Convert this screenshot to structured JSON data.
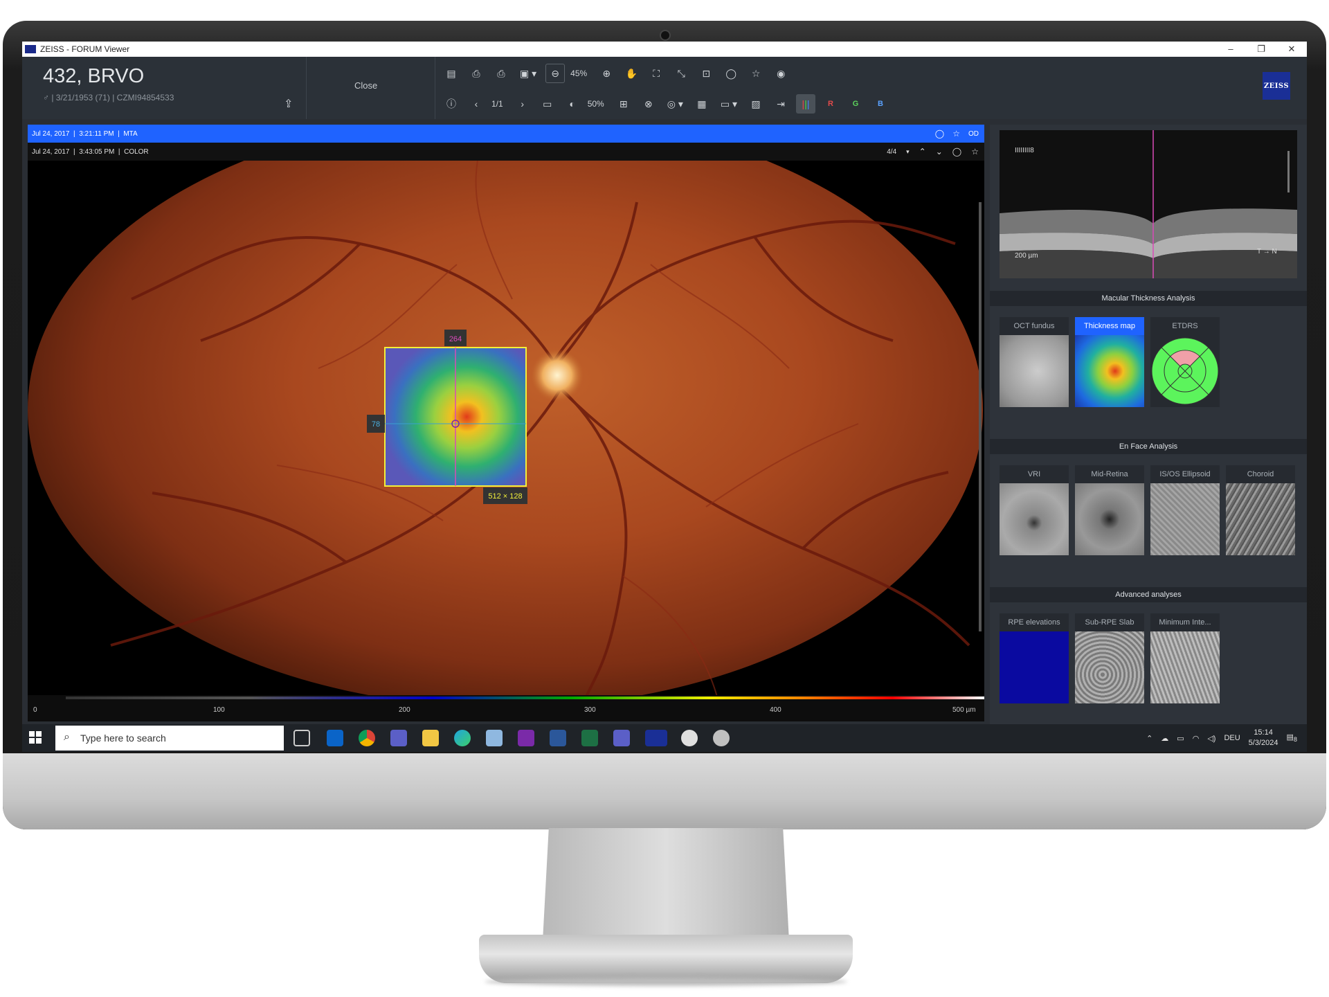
{
  "window": {
    "title": "ZEISS - FORUM Viewer",
    "min": "–",
    "max": "❐",
    "close": "✕"
  },
  "patient": {
    "name": "432, BRVO",
    "gender_icon": "♂",
    "dob": "3/21/1953 (71)",
    "id": "CZMI94854533"
  },
  "header": {
    "close_label": "Close"
  },
  "toolbar": {
    "zoom": "45%",
    "page": "1/1",
    "opacity": "50%",
    "red": "R",
    "green": "G",
    "blue": "B"
  },
  "study_bar": {
    "date": "Jul 24, 2017",
    "time": "3:21:11 PM",
    "modality": "MTA",
    "eye": "OD"
  },
  "image_bar": {
    "date": "Jul 24, 2017",
    "time": "3:43:05 PM",
    "type": "COLOR",
    "count": "4/4"
  },
  "overlay": {
    "top_value": "264",
    "left_value": "78",
    "size": "512 × 128"
  },
  "scale": {
    "labels": [
      "0",
      "100",
      "200",
      "300",
      "400",
      "500 µm"
    ]
  },
  "oct": {
    "scale_label": "200 µm",
    "orientation": "T → N",
    "marker": "IIIIIIII8"
  },
  "macular": {
    "title": "Macular Thickness Analysis",
    "thumbs": [
      {
        "label": "OCT fundus"
      },
      {
        "label": "Thickness map"
      },
      {
        "label": "ETDRS"
      }
    ]
  },
  "enface": {
    "title": "En Face Analysis",
    "thumbs": [
      {
        "label": "VRI"
      },
      {
        "label": "Mid-Retina"
      },
      {
        "label": "IS/OS Ellipsoid"
      },
      {
        "label": "Choroid"
      }
    ]
  },
  "advanced": {
    "title": "Advanced analyses",
    "thumbs": [
      {
        "label": "RPE elevations"
      },
      {
        "label": "Sub-RPE Slab"
      },
      {
        "label": "Minimum Inte..."
      }
    ]
  },
  "taskbar": {
    "search_placeholder": "Type here to search",
    "language": "DEU",
    "time": "15:14",
    "date": "5/3/2024",
    "notification_count": "8"
  },
  "colors": {
    "accent": "#1f63ff",
    "panel": "#2e333a",
    "zeiss_blue": "#1a2f96"
  }
}
